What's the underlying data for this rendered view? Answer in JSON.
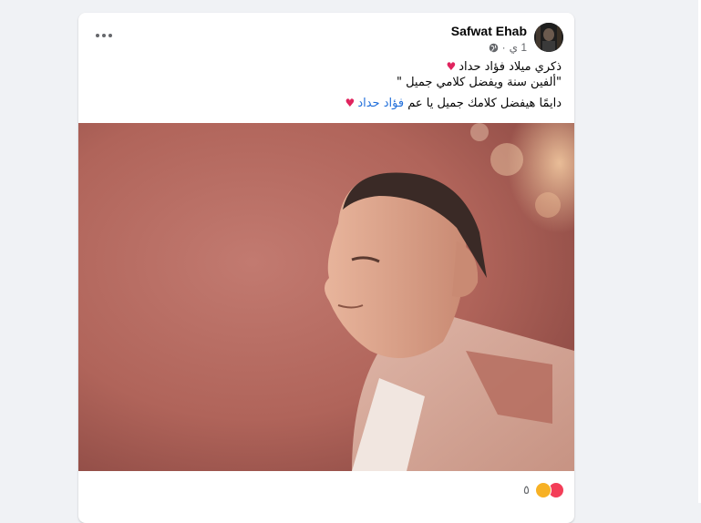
{
  "post": {
    "author": "Safwat Ehab",
    "time": "1 ي",
    "lines": [
      "ذكري ميلاد فؤاد حداد",
      "\"ألفين سنة ويفضل كلامي جميل \""
    ],
    "comment_prefix": "دايمًا هيفضل كلامك جميل يا عم",
    "mention": "فؤاد حداد",
    "reaction_count": "٥",
    "reactions": [
      "care-emoji-icon",
      "love-heart-icon"
    ],
    "colors": {
      "mention": "#216fdb",
      "heart": "#e0245e",
      "photo_tone": "#b5695e"
    }
  }
}
